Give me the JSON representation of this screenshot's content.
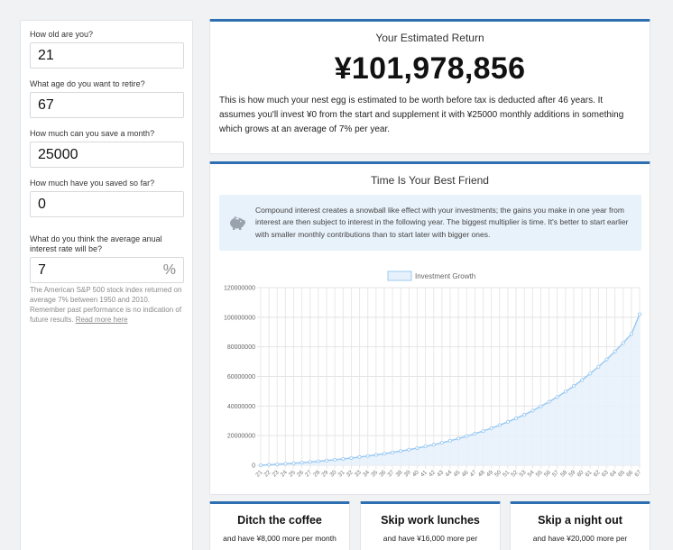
{
  "sidebar": {
    "age": {
      "label": "How old are you?",
      "value": "21"
    },
    "retire_age": {
      "label": "What age do you want to retire?",
      "value": "67"
    },
    "monthly": {
      "label": "How much can you save a month?",
      "value": "25000"
    },
    "saved": {
      "label": "How much have you saved so far?",
      "value": "0"
    },
    "rate": {
      "label": "What do you think the average anual interest rate will be?",
      "value": "7",
      "suffix": "%"
    },
    "note": "The American S&P 500 stock index returned on average 7% between 1950 and 2010. Remember past performance is no indication of future results.",
    "read_more": "Read more here"
  },
  "return_card": {
    "title": "Your Estimated Return",
    "amount": "¥101,978,856",
    "description": "This is how much your nest egg is estimated to be worth before tax is deducted after 46 years. It assumes you'll invest ¥0 from the start and supplement it with ¥25000 monthly additions in something which grows at an average of 7% per year."
  },
  "friend_card": {
    "title": "Time Is Your Best Friend",
    "info_icon": "piggy-bank-icon",
    "info": "Compound interest creates a snowball like effect with your investments; the gains you make in one year from interest are then subject to interest in the following year. The biggest multiplier is time. It's better to start earlier with smaller monthly contributions than to start later with bigger ones."
  },
  "chart_data": {
    "type": "area",
    "legend": "Investment Growth",
    "legend_position": "top-center",
    "grid": true,
    "ylim": [
      0,
      120000000
    ],
    "yticks": [
      "120000000",
      "100000000",
      "80000000",
      "60000000",
      "40000000",
      "20000000",
      "0"
    ],
    "x": [
      21,
      22,
      23,
      24,
      25,
      26,
      27,
      28,
      29,
      30,
      31,
      32,
      33,
      34,
      35,
      36,
      37,
      38,
      39,
      40,
      41,
      42,
      43,
      44,
      45,
      46,
      47,
      48,
      49,
      50,
      51,
      52,
      53,
      54,
      55,
      56,
      57,
      58,
      59,
      60,
      61,
      62,
      63,
      64,
      65,
      66,
      67
    ],
    "series": [
      {
        "name": "Investment Growth",
        "values": [
          0,
          310000,
          641700,
          996619,
          1376382,
          1782729,
          2217520,
          2682746,
          3180538,
          3713176,
          4283098,
          4892915,
          5545419,
          6243598,
          6990650,
          7789996,
          8645295,
          9560465,
          10539698,
          11587477,
          12708600,
          13908195,
          15191768,
          16565207,
          18034830,
          19607403,
          21290165,
          23090876,
          25017737,
          27079539,
          29285607,
          31645999,
          34171219,
          36873204,
          39764328,
          42857831,
          46168279,
          49711059,
          53502933,
          57561138,
          61904017,
          66551298,
          71524889,
          76847631,
          82543365,
          88637900,
          101978856
        ]
      }
    ],
    "colors": {
      "line": "#9ccaf2",
      "fill": "#e6f1fb",
      "point": "#9ccaf2"
    }
  },
  "tips": [
    {
      "title": "Ditch the coffee",
      "text": "and have ¥8,000 more per month"
    },
    {
      "title": "Skip work lunches",
      "text": "and have ¥16,000 more per"
    },
    {
      "title": "Skip a night out",
      "text": "and have ¥20,000 more per"
    }
  ]
}
